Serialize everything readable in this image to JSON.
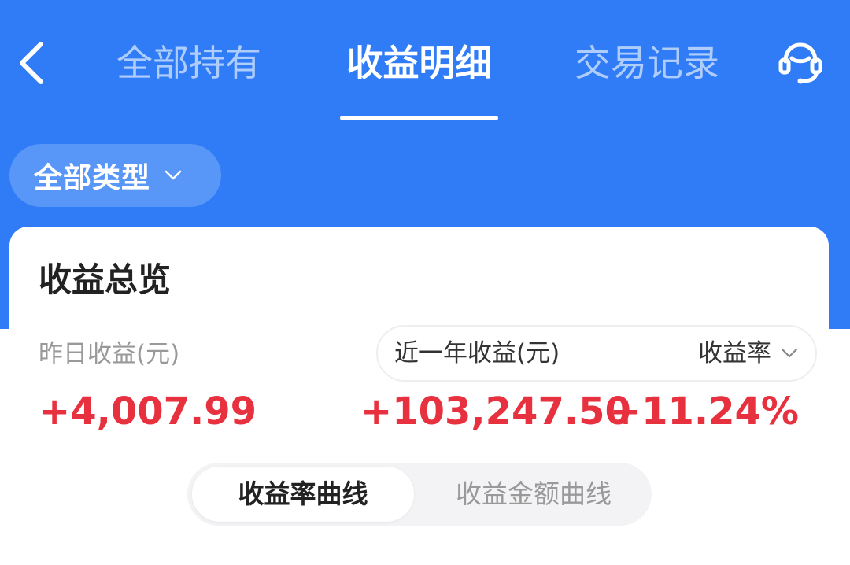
{
  "header": {
    "tabs": [
      {
        "label": "全部持有",
        "active": false
      },
      {
        "label": "收益明细",
        "active": true
      },
      {
        "label": "交易记录",
        "active": false
      }
    ]
  },
  "filter": {
    "label": "全部类型"
  },
  "overview": {
    "title": "收益总览",
    "yesterday_label": "昨日收益(元)",
    "yesterday_value": "+4,007.99",
    "year_label": "近一年收益(元)",
    "year_value": "+103,247.50",
    "rate_label": "收益率",
    "rate_value": "+11.24%"
  },
  "curve_toggle": {
    "options": [
      "收益率曲线",
      "收益金额曲线"
    ],
    "selected": "收益率曲线"
  },
  "colors": {
    "primary_blue": "#2f7cf6",
    "gain_red": "#e8313f"
  },
  "icons": {
    "back": "back-arrow-icon",
    "service": "customer-service-icon",
    "caret": "chevron-down-icon"
  }
}
